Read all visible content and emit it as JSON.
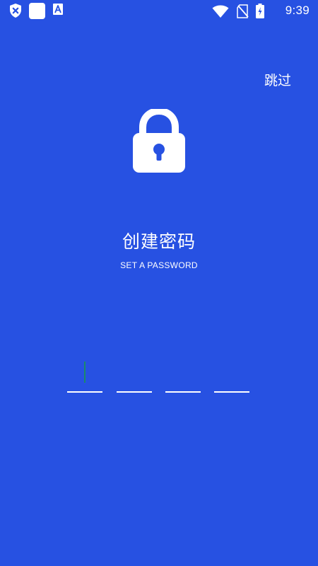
{
  "status_bar": {
    "time": "9:39",
    "left_icons": [
      "shield-x-icon",
      "white-square-icon",
      "font-a-icon"
    ],
    "right_icons": [
      "wifi-icon",
      "no-signal-icon",
      "battery-charging-icon"
    ]
  },
  "header": {
    "skip_label": "跳过"
  },
  "main": {
    "lock_icon": "lock-icon",
    "title": "创建密码",
    "subtitle": "SET A PASSWORD",
    "pin_slots": [
      {
        "value": "",
        "focused": true
      },
      {
        "value": "",
        "focused": false
      },
      {
        "value": "",
        "focused": false
      },
      {
        "value": "",
        "focused": false
      }
    ]
  },
  "colors": {
    "background": "#2751E2",
    "foreground": "#FFFFFF",
    "caret": "#1A8A6A"
  }
}
